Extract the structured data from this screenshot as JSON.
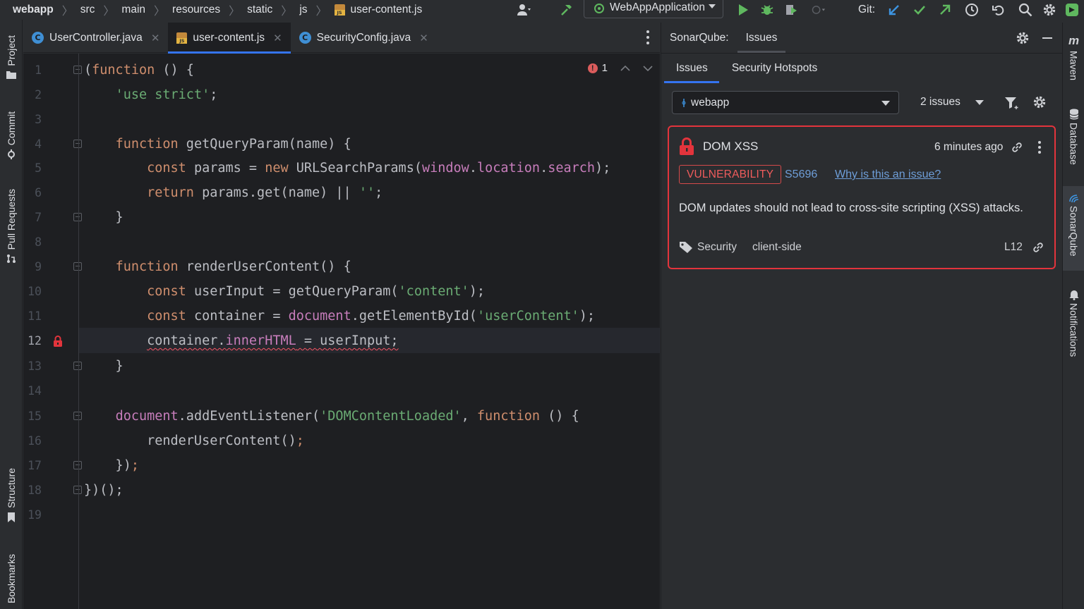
{
  "navbar": {
    "breadcrumbs": [
      "webapp",
      "src",
      "main",
      "resources",
      "static",
      "js",
      "user-content.js"
    ],
    "run_config": "WebAppApplication",
    "git_label": "Git:"
  },
  "left_stripe": {
    "tools": [
      "Project",
      "Commit",
      "Pull Requests",
      "Structure",
      "Bookmarks"
    ]
  },
  "editor": {
    "tabs": [
      {
        "label": "UserController.java",
        "icon": "java-class-icon",
        "active": false
      },
      {
        "label": "user-content.js",
        "icon": "javascript-file-icon",
        "active": true
      },
      {
        "label": "SecurityConfig.java",
        "icon": "java-class-icon",
        "active": false
      }
    ],
    "inspection_errors": "1",
    "current_line": 12,
    "line_numbers": [
      "1",
      "2",
      "3",
      "4",
      "5",
      "6",
      "7",
      "8",
      "9",
      "10",
      "11",
      "12",
      "13",
      "14",
      "15",
      "16",
      "17",
      "18",
      "19"
    ],
    "code": [
      "(function () {",
      "    'use strict';",
      "",
      "    function getQueryParam(name) {",
      "        const params = new URLSearchParams(window.location.search);",
      "        return params.get(name) || '';",
      "    }",
      "",
      "    function renderUserContent() {",
      "        const userInput = getQueryParam('content');",
      "        const container = document.getElementById('userContent');",
      "        container.innerHTML = userInput;",
      "    }",
      "",
      "    document.addEventListener('DOMContentLoaded', function () {",
      "        renderUserContent();",
      "    });",
      "})();",
      ""
    ]
  },
  "sonar": {
    "title": "SonarQube:",
    "header_tab": "Issues",
    "subtabs": [
      "Issues",
      "Security Hotspots"
    ],
    "project": "webapp",
    "issue_count": "2 issues",
    "issue": {
      "title": "DOM XSS",
      "time": "6 minutes ago",
      "type": "VULNERABILITY",
      "rule": "S5696",
      "why_link": "Why is this an issue?",
      "message": "DOM updates should not lead to cross-site scripting (XSS) attacks.",
      "tags": [
        "Security",
        "client-side"
      ],
      "line": "L12"
    }
  },
  "right_stripe": {
    "tools": [
      "Maven",
      "Database",
      "SonarQube",
      "Notifications"
    ]
  },
  "colors": {
    "editor_bg": "#1e1f22",
    "panel_bg": "#2b2d30",
    "keyword": "#cf8e6d",
    "string": "#6aab73",
    "global": "#c77dbb",
    "vulnerability": "#e3343c",
    "link": "#6e9ed8",
    "accent": "#3574f0"
  }
}
